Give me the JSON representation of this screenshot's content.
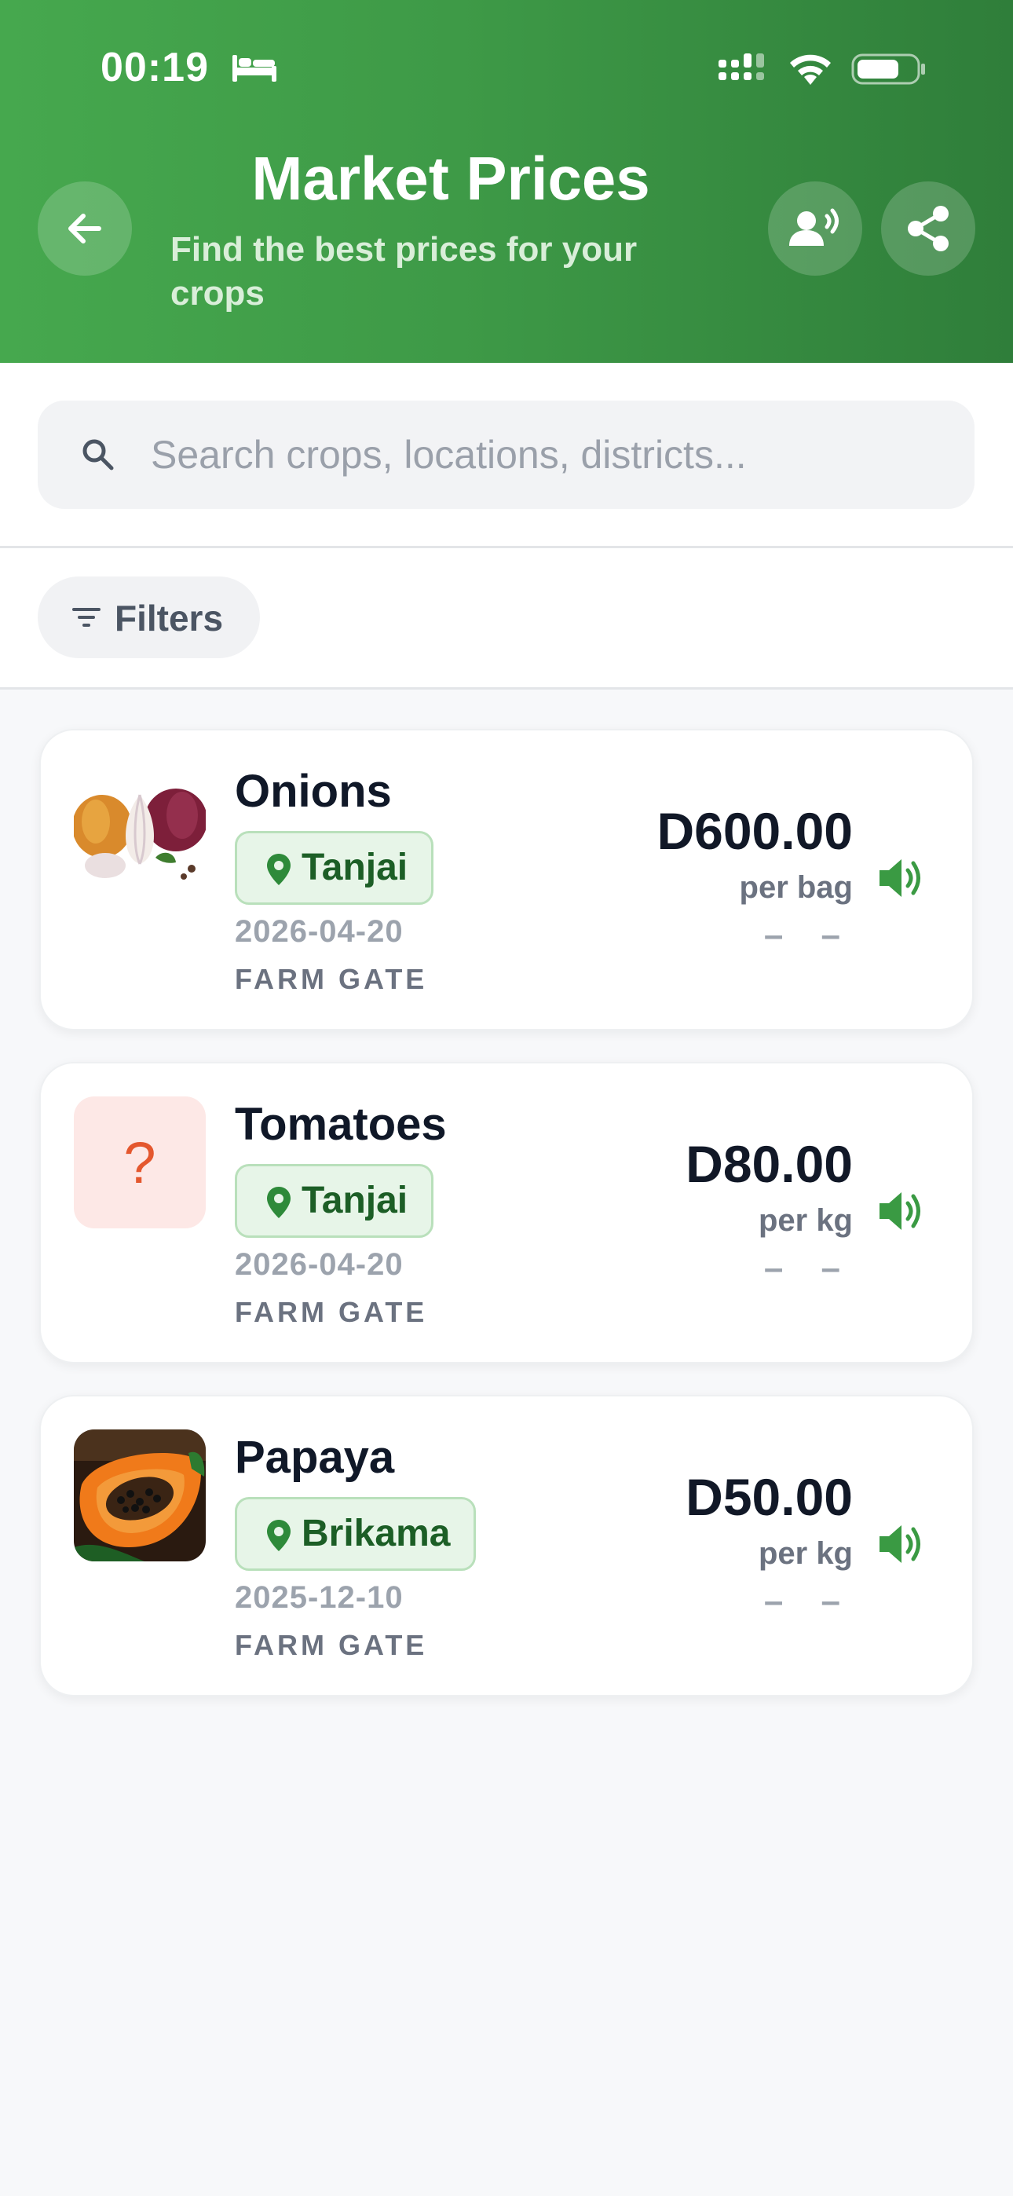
{
  "status_bar": {
    "time": "00:19"
  },
  "header": {
    "title": "Market Prices",
    "subtitle": "Find the best prices for your crops"
  },
  "search": {
    "placeholder": "Search crops, locations, districts...",
    "value": ""
  },
  "filters": {
    "label": "Filters"
  },
  "listings": [
    {
      "crop": "Onions",
      "location": "Tanjai",
      "date": "2026-04-20",
      "market_type": "FARM GATE",
      "price": "D600.00",
      "unit": "per bag",
      "change": "– –",
      "image": "onions-photo"
    },
    {
      "crop": "Tomatoes",
      "location": "Tanjai",
      "date": "2026-04-20",
      "market_type": "FARM GATE",
      "price": "D80.00",
      "unit": "per kg",
      "change": "– –",
      "image": "question-mark-placeholder",
      "placeholder_glyph": "?"
    },
    {
      "crop": "Papaya",
      "location": "Brikama",
      "date": "2025-12-10",
      "market_type": "FARM GATE",
      "price": "D50.00",
      "unit": "per kg",
      "change": "– –",
      "image": "papaya-photo"
    }
  ],
  "colors": {
    "header_green": "#3e9a47",
    "accent_green": "#3a9a43",
    "badge_bg": "#e7f5e8",
    "badge_text": "#1c5e26"
  }
}
